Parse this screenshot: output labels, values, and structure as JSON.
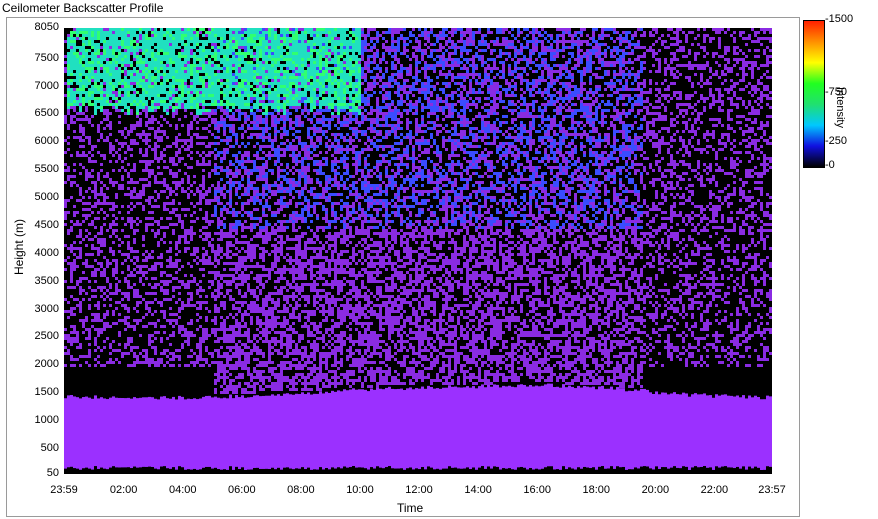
{
  "window": {
    "title": "Ceilometer Backscatter Profile"
  },
  "chart_data": {
    "type": "heatmap",
    "title": "Ceilometer Backscatter Profile",
    "xlabel": "Time",
    "ylabel": "Height (m)",
    "x_ticks": [
      "23:59",
      "02:00",
      "04:00",
      "06:00",
      "08:00",
      "10:00",
      "12:00",
      "14:00",
      "16:00",
      "18:00",
      "20:00",
      "22:00",
      "23:57"
    ],
    "x_range_hours": [
      -0.02,
      23.95
    ],
    "y_ticks": [
      50,
      500,
      1000,
      1500,
      2000,
      2500,
      3000,
      3500,
      4000,
      4500,
      5000,
      5500,
      6000,
      6500,
      7000,
      7500,
      8050
    ],
    "ylim": [
      50,
      8050
    ],
    "colorbar": {
      "label": "Intensity",
      "ticks": [
        1500,
        750,
        250,
        0
      ],
      "range": [
        0,
        1500
      ],
      "colors": [
        "#000000",
        "#1010e0",
        "#00c8ff",
        "#20e070",
        "#20ff20",
        "#ffff00",
        "#ff9000",
        "#ff2000"
      ]
    },
    "features": {
      "boundary_layer_top_m": [
        1450,
        1400,
        1420,
        1450,
        1500,
        1560,
        1600,
        1620,
        1650,
        1600,
        1550,
        1500,
        1450,
        1420
      ],
      "boundary_layer_hours": [
        0,
        2,
        4,
        6,
        8,
        10,
        12,
        14,
        16,
        18,
        19.5,
        20,
        22,
        24
      ],
      "cloud_layer": {
        "base_m": 6500,
        "top_m": 8050,
        "start_hour": 0,
        "end_hour": 10
      },
      "noise_floor_hours": [
        5,
        19.5
      ]
    },
    "colors": {
      "boundary_layer": "#9b30ff",
      "noise_purple": "#8a2be2",
      "noise_blue": "#3a4cff",
      "cloud_cyan": "#20e0c0",
      "cloud_green": "#30ff70"
    }
  }
}
